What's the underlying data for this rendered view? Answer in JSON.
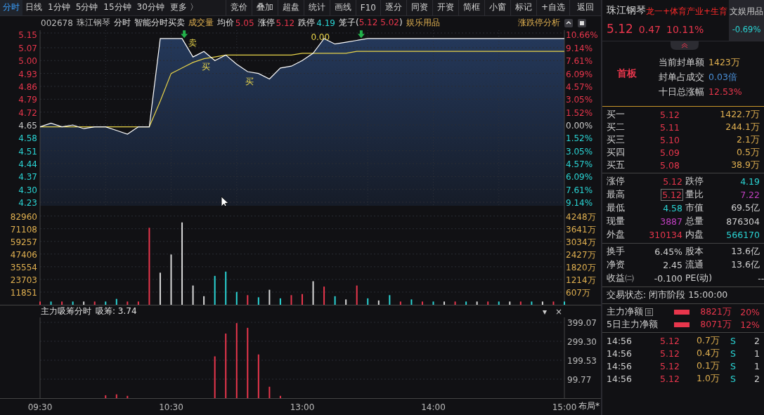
{
  "toolbar": {
    "tabs": [
      {
        "label": "分时",
        "selected": true
      },
      {
        "label": "日线",
        "selected": false
      },
      {
        "label": "1分钟",
        "selected": false
      },
      {
        "label": "5分钟",
        "selected": false
      },
      {
        "label": "15分钟",
        "selected": false
      },
      {
        "label": "30分钟",
        "selected": false
      },
      {
        "label": "更多 〉",
        "selected": false
      }
    ],
    "buttons": [
      "竞价",
      "叠加",
      "超盘",
      "统计",
      "画线",
      "F10",
      "逐分",
      "同资",
      "开资",
      "简框",
      "小窗",
      "标记",
      "+自选"
    ],
    "back": "返回"
  },
  "info_bar": {
    "code": "002678",
    "name": "珠江钢琴",
    "mode": "分时",
    "indicator": "智能分时买卖",
    "sub_indicator": "成交量",
    "items": [
      {
        "label": "均价",
        "value": "5.05",
        "color": "#e8364c"
      },
      {
        "label": "涨停",
        "value": "5.12",
        "color": "#e8364c"
      },
      {
        "label": "跌停",
        "value": "4.19",
        "color": "#2ad4d4"
      }
    ],
    "cage": {
      "prefix": "笼子(",
      "values": "5.12 5.02",
      "suffix": ")"
    },
    "industry": "娱乐用品",
    "analysis": "涨跌停分析"
  },
  "price_chart": {
    "percent_labels": [
      "10.66%",
      "9.14%",
      "7.61%",
      "6.09%",
      "4.57%",
      "3.05%",
      "1.52%",
      "0.00%",
      "1.52%",
      "3.05%",
      "4.57%",
      "6.09%",
      "7.61%",
      "9.14%"
    ],
    "chart_data": {
      "type": "line",
      "grid": true,
      "series": [
        {
          "color": "#ffffff",
          "values": [
            4.64,
            4.66,
            4.64,
            4.65,
            4.63,
            4.64,
            4.64,
            4.62,
            4.6,
            4.64,
            4.64,
            5.12,
            5.12,
            5.12,
            5.02,
            5.05,
            5.0,
            5.03,
            4.98,
            4.94,
            4.93,
            4.9,
            4.96,
            4.97,
            5.0,
            5.04,
            5.12,
            5.09,
            5.1,
            5.11,
            5.12,
            5.12,
            5.12,
            5.12,
            5.12,
            5.12,
            5.12,
            5.12,
            5.12,
            5.12,
            5.12,
            5.12,
            5.12,
            5.12,
            5.12,
            5.12,
            5.12,
            5.12,
            5.12
          ]
        },
        {
          "color": "#e8d44a",
          "values": [
            4.64,
            4.64,
            4.64,
            4.64,
            4.64,
            4.64,
            4.64,
            4.64,
            4.64,
            4.64,
            4.64,
            4.78,
            4.93,
            4.96,
            4.99,
            5.01,
            5.02,
            5.03,
            5.03,
            5.03,
            5.03,
            5.03,
            5.03,
            5.03,
            5.04,
            5.04,
            5.04,
            5.04,
            5.04,
            5.05,
            5.05,
            5.05,
            5.05,
            5.05,
            5.05,
            5.05,
            5.05,
            5.05,
            5.05,
            5.05,
            5.05,
            5.05,
            5.05,
            5.05,
            5.05,
            5.05,
            5.05,
            5.05,
            5.05
          ]
        }
      ],
      "ylim": [
        4.23,
        5.15
      ],
      "yticks": [
        {
          "value": 5.15,
          "label": "5.15"
        },
        {
          "value": 5.07,
          "label": "5.07"
        },
        {
          "value": 5.0,
          "label": "5.00"
        },
        {
          "value": 4.93,
          "label": "4.93"
        },
        {
          "value": 4.86,
          "label": "4.86"
        },
        {
          "value": 4.79,
          "label": "4.79"
        },
        {
          "value": 4.72,
          "label": "4.72"
        },
        {
          "value": 4.65,
          "label": "4.65"
        },
        {
          "value": 4.58,
          "label": "4.58"
        },
        {
          "value": 4.51,
          "label": "4.51"
        },
        {
          "value": 4.44,
          "label": "4.44"
        },
        {
          "value": 4.37,
          "label": "4.37"
        },
        {
          "value": 4.3,
          "label": "4.30"
        },
        {
          "value": 4.23,
          "label": "4.23"
        }
      ],
      "annotations": [
        "卖",
        "买",
        "买",
        "0.00"
      ]
    }
  },
  "volume_chart": {
    "amount_labels": [
      "4248万",
      "3641万",
      "3034万",
      "2427万",
      "1820万",
      "1214万",
      "607万"
    ],
    "chart_data": {
      "type": "bar",
      "grid": true,
      "series": [
        {
          "color": "#e8364c",
          "values": [
            3000,
            null,
            3000,
            null,
            null,
            3000,
            null,
            null,
            3000,
            3000,
            72000,
            null,
            null,
            null,
            null,
            null,
            null,
            null,
            null,
            9000,
            null,
            null,
            null,
            9000,
            10000,
            null,
            17000,
            null,
            null,
            18000,
            null,
            null,
            null,
            3000,
            null,
            3000,
            null,
            null,
            3000,
            null,
            null,
            3000,
            null,
            null,
            3000,
            null,
            null,
            3000,
            null
          ]
        },
        {
          "color": "#2ad4d4",
          "values": [
            null,
            3000,
            null,
            3000,
            null,
            null,
            3000,
            5500,
            null,
            null,
            null,
            null,
            null,
            null,
            null,
            null,
            27000,
            31000,
            12000,
            null,
            7000,
            null,
            6000,
            null,
            null,
            null,
            null,
            8000,
            null,
            null,
            6000,
            null,
            9000,
            null,
            5000,
            null,
            3000,
            null,
            null,
            3000,
            null,
            null,
            3000,
            null,
            null,
            3000,
            null,
            null,
            3000
          ]
        },
        {
          "color": "#d8d8d8",
          "values": [
            null,
            null,
            null,
            null,
            3000,
            null,
            null,
            null,
            null,
            null,
            null,
            30000,
            47000,
            77000,
            18000,
            8000,
            null,
            null,
            null,
            null,
            null,
            14000,
            null,
            null,
            null,
            22000,
            null,
            null,
            5000,
            null,
            null,
            4000,
            null,
            null,
            null,
            null,
            null,
            3000,
            null,
            null,
            3000,
            null,
            null,
            3000,
            null,
            null,
            3000,
            null,
            null
          ]
        }
      ],
      "ylim": [
        0,
        92600
      ],
      "yticks": [
        82960,
        71108,
        59257,
        47406,
        35554,
        23703,
        11851
      ]
    }
  },
  "indicator_chart": {
    "name": "主力吸筹分时",
    "reading": "吸筹: 3.74",
    "menu": "▾",
    "close": "×",
    "layout": "布局*",
    "chart_data": {
      "type": "bar",
      "grid": true,
      "categories": [
        "09:30",
        null,
        null,
        null,
        null,
        null,
        null,
        null,
        null,
        null,
        null,
        null,
        "10:30",
        null,
        null,
        null,
        null,
        null,
        null,
        null,
        null,
        null,
        null,
        null,
        "13:00",
        null,
        null,
        null,
        null,
        null,
        null,
        null,
        null,
        null,
        null,
        null,
        "14:00",
        null,
        null,
        null,
        null,
        null,
        null,
        null,
        null,
        null,
        null,
        null,
        "15:00"
      ],
      "series": [
        {
          "color": "#e8364c",
          "values": [
            null,
            null,
            null,
            null,
            null,
            null,
            15,
            20,
            12,
            null,
            null,
            null,
            null,
            null,
            null,
            null,
            220,
            340,
            395,
            370,
            230,
            60,
            12,
            null,
            null,
            null,
            null,
            null,
            null,
            null,
            null,
            null,
            null,
            null,
            null,
            null,
            null,
            null,
            null,
            null,
            null,
            null,
            null,
            null,
            null,
            null,
            null,
            null,
            null
          ]
        }
      ],
      "ylim": [
        0,
        425
      ],
      "yticks": [
        {
          "value": 399.07,
          "label": "399.07"
        },
        {
          "value": 299.3,
          "label": "299.30"
        },
        {
          "value": 199.53,
          "label": "199.53"
        },
        {
          "value": 99.77,
          "label": "99.77"
        }
      ]
    }
  },
  "quote_panel": {
    "name": "珠江钢琴",
    "concepts": "龙一+体育产业+生育",
    "sector": {
      "name": "文娱用品",
      "change": "-0.69%"
    },
    "price": "5.12",
    "change": "0.47",
    "change_pct": "10.11%",
    "board": "首板",
    "seal": [
      {
        "label": "当前封单额",
        "value": "1423万",
        "color": "#e0b050"
      },
      {
        "label": "封单占成交",
        "value": "0.03倍",
        "color": "#4a90d9"
      },
      {
        "label": "十日总涨幅",
        "value": "12.53%",
        "color": "#e8364c"
      }
    ],
    "order_book": [
      {
        "label": "买一",
        "price": "5.12",
        "volume": "1422.7万"
      },
      {
        "label": "买二",
        "price": "5.11",
        "volume": "244.1万"
      },
      {
        "label": "买三",
        "price": "5.10",
        "volume": "2.1万"
      },
      {
        "label": "买四",
        "price": "5.09",
        "volume": "0.5万"
      },
      {
        "label": "买五",
        "price": "5.08",
        "volume": "38.9万"
      }
    ],
    "stats": [
      [
        [
          {
            "label": "涨停",
            "value": "5.12",
            "color": "#e8364c",
            "boxed": false
          },
          {
            "label": "跌停",
            "value": "4.19",
            "color": "#2ad4d4",
            "boxed": false
          }
        ],
        [
          {
            "label": "最高",
            "value": "5.12",
            "color": "#e8364c",
            "boxed": true
          },
          {
            "label": "量比",
            "value": "7.22",
            "color": "#c040c0",
            "boxed": false
          }
        ],
        [
          {
            "label": "最低",
            "value": "4.58",
            "color": "#2ad4d4",
            "boxed": false
          },
          {
            "label": "市值",
            "value": "69.5亿",
            "color": "#d0d0d0",
            "boxed": false
          }
        ],
        [
          {
            "label": "现量",
            "value": "3887",
            "color": "#c040c0",
            "boxed": false
          },
          {
            "label": "总量",
            "value": "876304",
            "color": "#d0d0d0",
            "boxed": false
          }
        ],
        [
          {
            "label": "外盘",
            "value": "310134",
            "color": "#e8364c",
            "boxed": false
          },
          {
            "label": "内盘",
            "value": "566170",
            "color": "#2ad4d4",
            "boxed": false
          }
        ]
      ],
      [
        [
          {
            "label": "换手",
            "value": "6.45%",
            "color": "#d0d0d0",
            "boxed": false
          },
          {
            "label": "股本",
            "value": "13.6亿",
            "color": "#d0d0d0",
            "boxed": false
          }
        ],
        [
          {
            "label": "净资",
            "value": "2.45",
            "color": "#d0d0d0",
            "boxed": false
          },
          {
            "label": "流通",
            "value": "13.6亿",
            "color": "#d0d0d0",
            "boxed": false
          }
        ],
        [
          {
            "label": "收益㈡",
            "value": "-0.100",
            "color": "#d0d0d0",
            "boxed": false
          },
          {
            "label": "PE(动)",
            "value": "--",
            "color": "#d0d0d0",
            "boxed": false
          }
        ]
      ]
    ],
    "status": "交易状态: 闭市阶段 15:00:00",
    "net_flow": [
      {
        "label": "主力净额",
        "note_icon": true,
        "value": "8821万",
        "percent": "20%"
      },
      {
        "label": "5日主力净额",
        "note_icon": false,
        "value": "8071万",
        "percent": "12%"
      }
    ],
    "trades": [
      {
        "time": "14:56",
        "price": "5.12",
        "volume": "0.7万",
        "side": "S",
        "column_5": "2"
      },
      {
        "time": "14:56",
        "price": "5.12",
        "volume": "0.4万",
        "side": "S",
        "column_5": "1"
      },
      {
        "time": "14:56",
        "price": "5.12",
        "volume": "0.1万",
        "side": "S",
        "column_5": "1"
      },
      {
        "time": "14:56",
        "price": "5.12",
        "volume": "1.0万",
        "side": "S",
        "column_5": "2"
      }
    ]
  }
}
